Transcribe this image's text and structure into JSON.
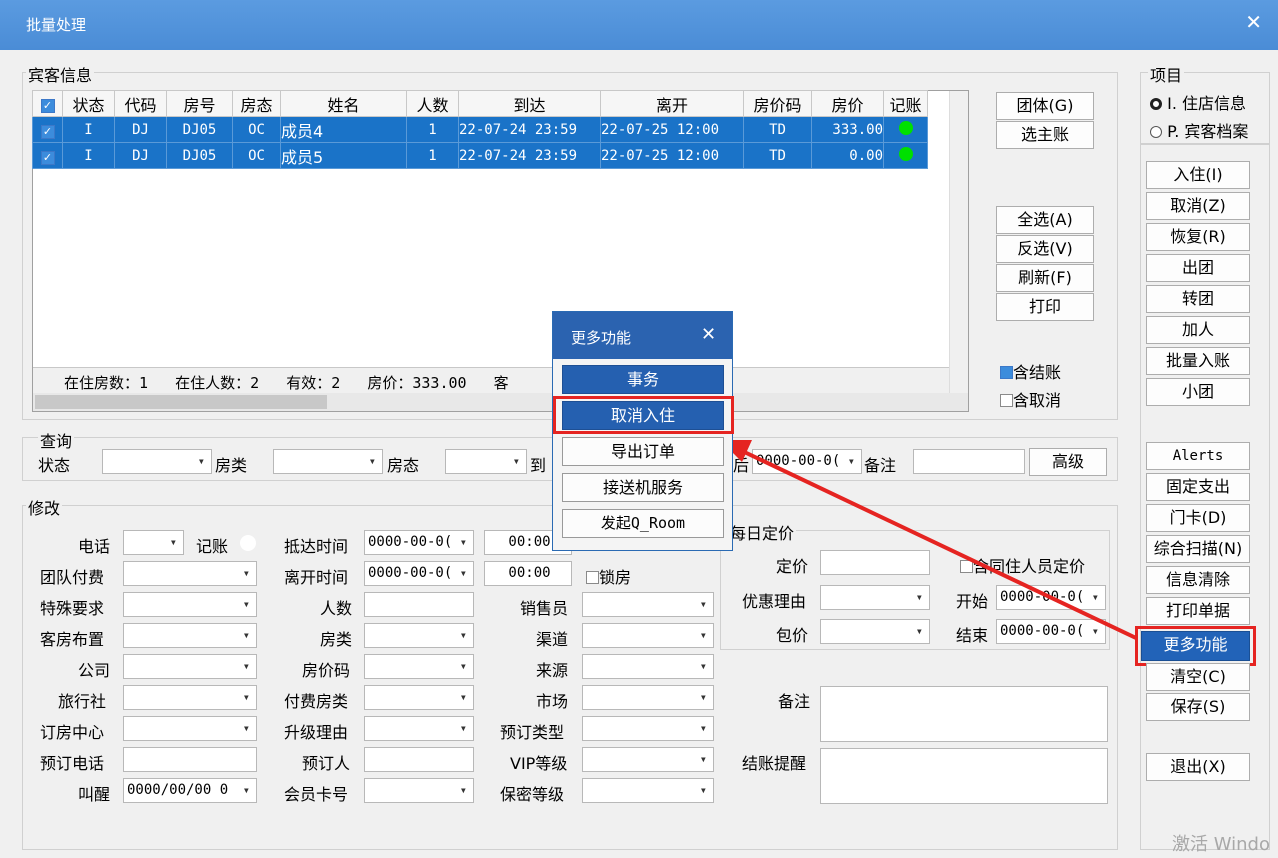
{
  "window": {
    "title": "批量处理",
    "close": "✕"
  },
  "guest_group": {
    "label": "宾客信息"
  },
  "table": {
    "headers": [
      "状态",
      "代码",
      "房号",
      "房态",
      "姓名",
      "人数",
      "到达",
      "离开",
      "房价码",
      "房价",
      "记账"
    ],
    "rows": [
      {
        "status": "I",
        "code": "DJ",
        "room": "DJ05",
        "room_status": "OC",
        "name": "成员4",
        "count": "1",
        "arrive": "22-07-24 23:59",
        "depart": "22-07-25 12:00",
        "rate_code": "TD",
        "rate": "333.00"
      },
      {
        "status": "I",
        "code": "DJ",
        "room": "DJ05",
        "room_status": "OC",
        "name": "成员5",
        "count": "1",
        "arrive": "22-07-24 23:59",
        "depart": "22-07-25 12:00",
        "rate_code": "TD",
        "rate": "0.00"
      }
    ],
    "footer": "在住房数：1   在住人数：2   有效：2   房价：333.00   客"
  },
  "side_buttons": {
    "group": "团体(G)",
    "select_main": "选主账",
    "select_all": "全选(A)",
    "invert": "反选(V)",
    "refresh": "刷新(F)",
    "print": "打印"
  },
  "checks": {
    "include_checkout": "含结账",
    "include_cancel": "含取消"
  },
  "query": {
    "label": "查询",
    "status": "状态",
    "room_type": "房类",
    "room_status": "房态",
    "arrive": "到",
    "date_partial": "0000-00-0(",
    "note": "备注",
    "advanced": "高级",
    "char_partial": "后"
  },
  "items": {
    "label": "项目",
    "opt1": "I. 住店信息",
    "opt2": "P. 宾客档案"
  },
  "right_buttons": [
    "入住(I)",
    "取消(Z)",
    "恢复(R)",
    "出团",
    "转团",
    "加人",
    "批量入账",
    "小团"
  ],
  "right_buttons2": [
    "Alerts",
    "固定支出",
    "门卡(D)",
    "综合扫描(N)",
    "信息清除",
    "打印单据",
    "更多功能",
    "清空(C)",
    "保存(S)"
  ],
  "exit": "退出(X)",
  "modify": {
    "label": "修改",
    "phone": "电话",
    "account": "记账",
    "arrival_time": "抵达时间",
    "date_val": "0000-00-0(",
    "time1": "00:00",
    "time2": "00:00",
    "group_pay": "团队付费",
    "depart_time": "离开时间",
    "lock_room": "锁房",
    "special": "特殊要求",
    "persons": "人数",
    "salesman": "销售员",
    "layout": "客房布置",
    "room_type": "房类",
    "channel": "渠道",
    "company": "公司",
    "rate_code": "房价码",
    "source": "来源",
    "agency": "旅行社",
    "pay_room_type": "付费房类",
    "market": "市场",
    "booking_center": "订房中心",
    "upgrade": "升级理由",
    "booking_type": "预订类型",
    "booking_phone": "预订电话",
    "booker": "预订人",
    "vip": "VIP等级",
    "wake": "叫醒",
    "wake_val": "0000/00/00 0",
    "member_card": "会员卡号",
    "secret": "保密等级"
  },
  "daily": {
    "label": "每日定价",
    "price": "定价",
    "with_roommates": "含同住人员定价",
    "discount": "优惠理由",
    "start": "开始",
    "package": "包价",
    "end": "结束",
    "date": "0000-00-0(",
    "note": "备注",
    "checkout_remind": "结账提醒"
  },
  "popup": {
    "title": "更多功能",
    "close": "✕",
    "items": [
      "事务",
      "取消入住",
      "导出订单",
      "接送机服务",
      "发起Q_Room"
    ]
  },
  "watermark": "激活 Windo",
  "colors": {
    "titlebar": "#4a8cd6",
    "selection": "#1a73c8",
    "highlight": "#e52421",
    "status_ok": "#00e000"
  }
}
